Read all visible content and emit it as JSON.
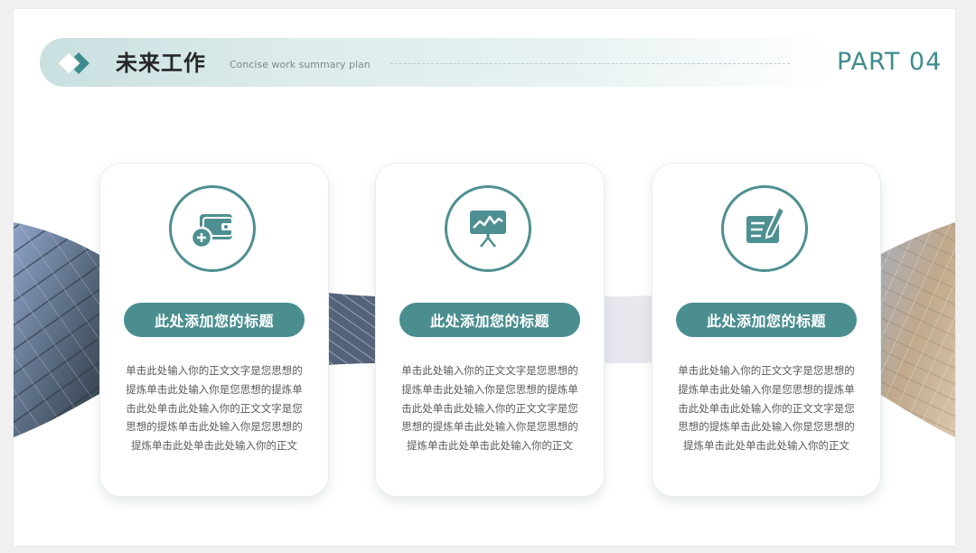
{
  "header": {
    "title": "未来工作",
    "subtitle": "Concise work summary plan",
    "part_label": "PART 04"
  },
  "cards": [
    {
      "icon": "wallet-icon",
      "title": "此处添加您的标题",
      "body": "单击此处输入你的正文文字是您思想的提炼单击此处输入你是您思想的提炼单击此处单击此处输入你的正文文字是您思想的提炼单击此处输入你是您思想的提炼单击此处单击此处输入你的正文"
    },
    {
      "icon": "presentation-chart-icon",
      "title": "此处添加您的标题",
      "body": "单击此处输入你的正文文字是您思想的提炼单击此处输入你是您思想的提炼单击此处单击此处输入你的正文文字是您思想的提炼单击此处输入你是您思想的提炼单击此处单击此处输入你的正文"
    },
    {
      "icon": "edit-document-icon",
      "title": "此处添加您的标题",
      "body": "单击此处输入你的正文文字是您思想的提炼单击此处输入你是您思想的提炼单击此处单击此处输入你的正文文字是您思想的提炼单击此处输入你是您思想的提炼单击此处单击此处输入你的正文"
    }
  ],
  "colors": {
    "accent": "#4a8e90",
    "title_text": "#262626",
    "body_text": "#595959"
  }
}
